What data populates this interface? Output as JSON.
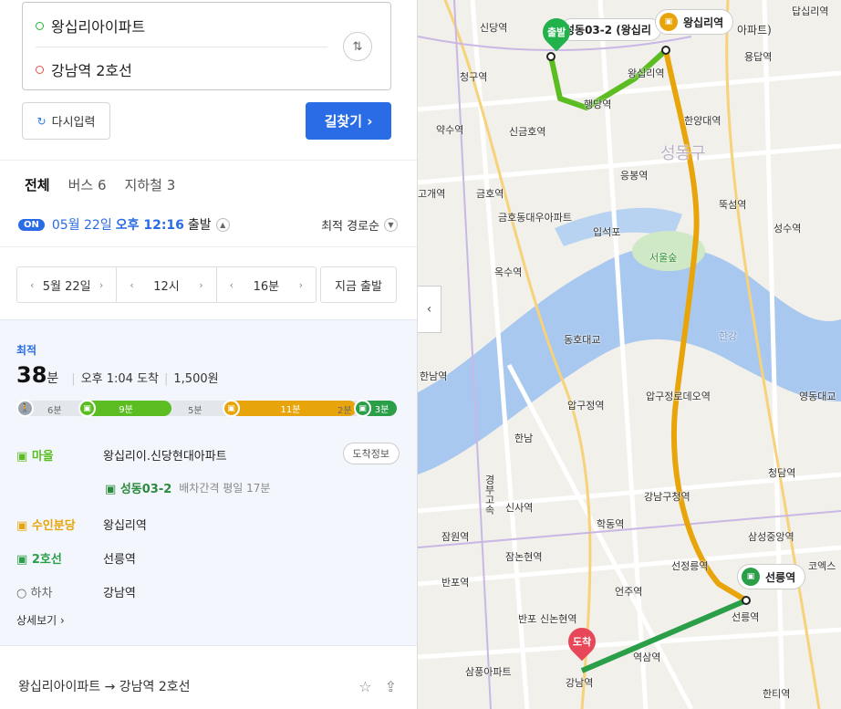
{
  "search": {
    "origin": "왕십리아이파트",
    "destination": "강남역 2호선",
    "reset_label": "다시입력",
    "find_label": "길찾기 ›"
  },
  "tabs": [
    "전체",
    "버스 6",
    "지하철 3"
  ],
  "depart": {
    "badge": "ON",
    "date": "05월 22일",
    "time": "오후 12:16",
    "label": "출발",
    "sort": "최적 경로순"
  },
  "time_picker": {
    "date": "5월 22일",
    "hour": "12시",
    "minute": "16분",
    "now": "지금 출발"
  },
  "result": {
    "badge": "최적",
    "minutes": "38",
    "unit": "분",
    "arrival": "오후 1:04 도착",
    "fare": "1,500원",
    "segments": [
      {
        "label": "6분",
        "type": "walk"
      },
      {
        "label": "9분",
        "type": "green"
      },
      {
        "label": "5분",
        "type": "walk"
      },
      {
        "label": "11분",
        "type": "orange"
      },
      {
        "label": "2분",
        "type": "walk"
      },
      {
        "label": "3분",
        "type": "dgreen"
      }
    ],
    "steps": [
      {
        "mode": "마을",
        "place": "왕십리이.신당현대아파트",
        "color": "#5bbd21"
      },
      {
        "mode": "수인분당",
        "place": "왕십리역",
        "color": "#e8a50b"
      },
      {
        "mode": "2호선",
        "place": "선릉역",
        "color": "#2b9e48"
      },
      {
        "mode": "하차",
        "place": "강남역",
        "color": "#666666"
      }
    ],
    "arrival_info": "도착정보",
    "bus_route": "성동03-2",
    "bus_interval": "배차간격 평일 17분",
    "detail": "상세보기 ›"
  },
  "footer": {
    "route": "왕십리아이파트 → 강남역 2호선"
  },
  "map": {
    "start_pin": "출발",
    "end_pin": "도착",
    "pill_top_station": "왕십리역",
    "pill_top_route": "성동03-2 (왕십리",
    "pill_top_route_tail": "아파트)",
    "pill_seolleung": "선릉역",
    "labels": [
      "신당역",
      "답십리역",
      "용답역",
      "청구역",
      "왕십리역",
      "행당역",
      "한양대역",
      "약수역",
      "신금호역",
      "성동구",
      "응봉역",
      "뚝섬역",
      "성수역",
      "고개역",
      "금호역",
      "금호동대우아파트",
      "입석포",
      "서울숲",
      "옥수역",
      "동호대교",
      "한강",
      "한남역",
      "압구정역",
      "압구정로데오역",
      "영동대교",
      "한남",
      "청담역",
      "신사역",
      "강남구청역",
      "학동역",
      "삼성중앙역",
      "잠원역",
      "잠논현역",
      "선정릉역",
      "코엑스",
      "반포역",
      "언주역",
      "선릉역",
      "반포",
      "신논현역",
      "역삼역",
      "삼풍아파트",
      "강남역",
      "한티역",
      "경부고속"
    ]
  }
}
